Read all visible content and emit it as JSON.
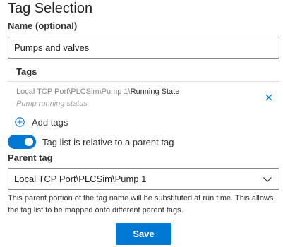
{
  "title": "Tag Selection",
  "name_field": {
    "label": "Name (optional)",
    "value": "Pumps and valves"
  },
  "tags": {
    "header": "Tags",
    "items": [
      {
        "path_prefix": "Local TCP Port\\PLCSim\\Pump 1\\",
        "leaf": "Running State",
        "description": "Pump running status"
      }
    ],
    "add_label": "Add tags"
  },
  "relative_toggle": {
    "label": "Tag list is relative to a parent tag",
    "on": true
  },
  "parent_tag": {
    "label": "Parent tag",
    "selected": "Local TCP Port\\PLCSim\\Pump 1",
    "help": "This parent portion of the tag name will be substituted at run time. This allows the tag list to be mapped onto different parent tags."
  },
  "save_label": "Save",
  "colors": {
    "accent": "#0078d4",
    "text": "#323130",
    "muted": "#8a8886"
  },
  "icons": {
    "remove": "close-icon",
    "add": "plus-circle-icon",
    "dropdown": "chevron-down-icon"
  }
}
